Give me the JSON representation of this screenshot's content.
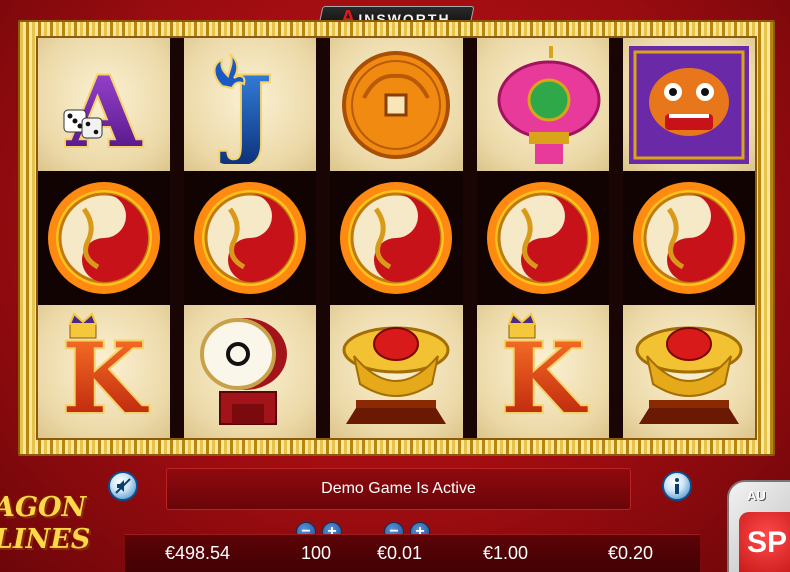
{
  "brand": {
    "initial": "A",
    "rest": "INSWORTH"
  },
  "reels": [
    [
      "ace-dice",
      "yin-yang-dragon",
      "king-crown"
    ],
    [
      "jack-fleur",
      "yin-yang-dragon",
      "drum"
    ],
    [
      "coin",
      "yin-yang-dragon",
      "gold-ingot"
    ],
    [
      "lantern",
      "yin-yang-dragon",
      "king-crown"
    ],
    [
      "dragon-mask",
      "yin-yang-dragon",
      "gold-ingot"
    ]
  ],
  "symbol_letters": {
    "ace": "A",
    "jack": "J",
    "king": "K"
  },
  "message": "Demo Game Is Active",
  "logo": {
    "line1": "AGON",
    "line2": "LINES"
  },
  "stats": {
    "balance": "€498.54",
    "lines": "100",
    "line_bet": "€0.01",
    "total_bet": "€1.00",
    "win": "€0.20"
  },
  "spin": {
    "auto_label": "AU",
    "spin_label": "SP"
  },
  "colors": {
    "background": "#b50f14",
    "frame_gold": "#e6c34a",
    "button_blue": "#2c7cc0"
  }
}
